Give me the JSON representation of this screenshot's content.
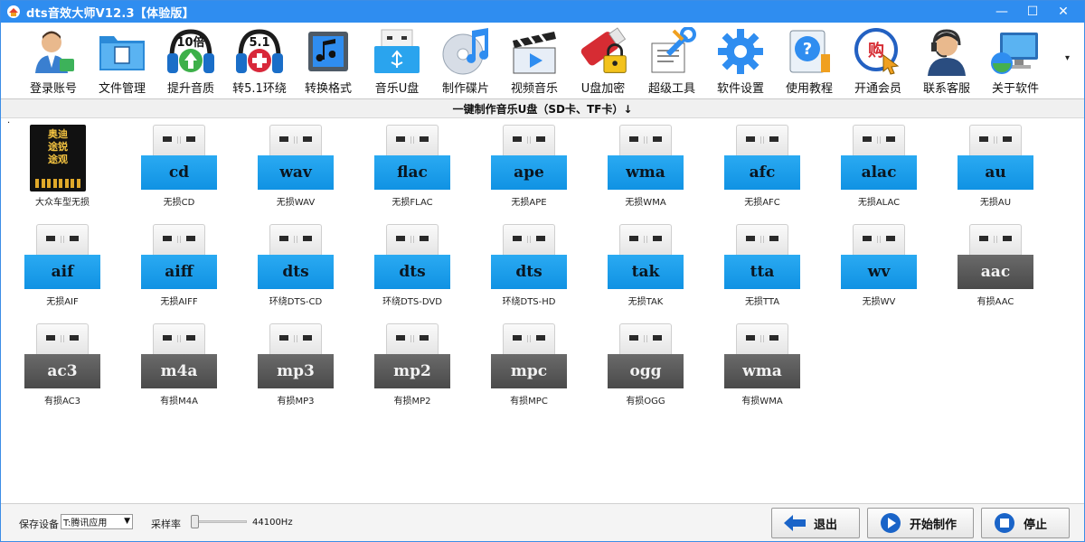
{
  "window": {
    "title": "dts音效大师V12.3【体验版】",
    "controls": {
      "minimize": "—",
      "maximize": "☐",
      "close": "✕"
    }
  },
  "toolbar": {
    "items": [
      {
        "label": "登录账号",
        "icon": "user-login-icon"
      },
      {
        "label": "文件管理",
        "icon": "folder-icon"
      },
      {
        "label": "提升音质",
        "icon": "headphones-10x-icon",
        "badge": "10倍"
      },
      {
        "label": "转5.1环绕",
        "icon": "headphones-51-icon",
        "badge": "5.1"
      },
      {
        "label": "转换格式",
        "icon": "music-convert-icon"
      },
      {
        "label": "音乐U盘",
        "icon": "usb-drive-icon"
      },
      {
        "label": "制作碟片",
        "icon": "disc-music-icon"
      },
      {
        "label": "视频音乐",
        "icon": "video-clapper-icon"
      },
      {
        "label": "U盘加密",
        "icon": "usb-lock-icon"
      },
      {
        "label": "超级工具",
        "icon": "tools-icon"
      },
      {
        "label": "软件设置",
        "icon": "gear-icon"
      },
      {
        "label": "使用教程",
        "icon": "help-icon"
      },
      {
        "label": "开通会员",
        "icon": "vip-buy-icon",
        "badge": "购"
      },
      {
        "label": "联系客服",
        "icon": "customer-service-icon"
      },
      {
        "label": "关于软件",
        "icon": "about-computer-icon"
      }
    ],
    "more": "▾"
  },
  "section": {
    "title": "一键制作音乐U盘（SD卡、TF卡）↓"
  },
  "grid": {
    "marker": "·",
    "items": [
      {
        "type": "sd",
        "card_text": [
          "奥迪",
          "途锐",
          "途观"
        ],
        "caption": "大众车型无损"
      },
      {
        "type": "usb",
        "color": "blue",
        "label": "cd",
        "caption": "无损CD"
      },
      {
        "type": "usb",
        "color": "blue",
        "label": "wav",
        "caption": "无损WAV"
      },
      {
        "type": "usb",
        "color": "blue",
        "label": "flac",
        "caption": "无损FLAC"
      },
      {
        "type": "usb",
        "color": "blue",
        "label": "ape",
        "caption": "无损APE"
      },
      {
        "type": "usb",
        "color": "blue",
        "label": "wma",
        "caption": "无损WMA"
      },
      {
        "type": "usb",
        "color": "blue",
        "label": "afc",
        "caption": "无损AFC"
      },
      {
        "type": "usb",
        "color": "blue",
        "label": "alac",
        "caption": "无损ALAC"
      },
      {
        "type": "usb",
        "color": "blue",
        "label": "au",
        "caption": "无损AU"
      },
      {
        "type": "usb",
        "color": "blue",
        "label": "aif",
        "caption": "无损AIF"
      },
      {
        "type": "usb",
        "color": "blue",
        "label": "aiff",
        "caption": "无损AIFF"
      },
      {
        "type": "usb",
        "color": "blue",
        "label": "dts",
        "caption": "环绕DTS-CD"
      },
      {
        "type": "usb",
        "color": "blue",
        "label": "dts",
        "caption": "环绕DTS-DVD"
      },
      {
        "type": "usb",
        "color": "blue",
        "label": "dts",
        "caption": "环绕DTS-HD"
      },
      {
        "type": "usb",
        "color": "blue",
        "label": "tak",
        "caption": "无损TAK"
      },
      {
        "type": "usb",
        "color": "blue",
        "label": "tta",
        "caption": "无损TTA"
      },
      {
        "type": "usb",
        "color": "blue",
        "label": "wv",
        "caption": "无损WV"
      },
      {
        "type": "usb",
        "color": "gray",
        "label": "aac",
        "caption": "有损AAC"
      },
      {
        "type": "usb",
        "color": "gray",
        "label": "ac3",
        "caption": "有损AC3"
      },
      {
        "type": "usb",
        "color": "gray",
        "label": "m4a",
        "caption": "有损M4A"
      },
      {
        "type": "usb",
        "color": "gray",
        "label": "mp3",
        "caption": "有损MP3"
      },
      {
        "type": "usb",
        "color": "gray",
        "label": "mp2",
        "caption": "有损MP2"
      },
      {
        "type": "usb",
        "color": "gray",
        "label": "mpc",
        "caption": "有损MPC"
      },
      {
        "type": "usb",
        "color": "gray",
        "label": "ogg",
        "caption": "有损OGG"
      },
      {
        "type": "usb",
        "color": "gray",
        "label": "wma",
        "caption": "有损WMA"
      }
    ]
  },
  "status": {
    "device_label": "保存设备",
    "device_value": "T:腾讯应用",
    "rate_label": "采样率",
    "rate_value": "44100Hz",
    "rate_slider_fraction": 0.0,
    "buttons": {
      "exit": "退出",
      "start": "开始制作",
      "stop": "停止"
    }
  },
  "colors": {
    "titlebar": "#2f8df0",
    "lossless": "#1a9be8",
    "lossy": "#555555"
  }
}
